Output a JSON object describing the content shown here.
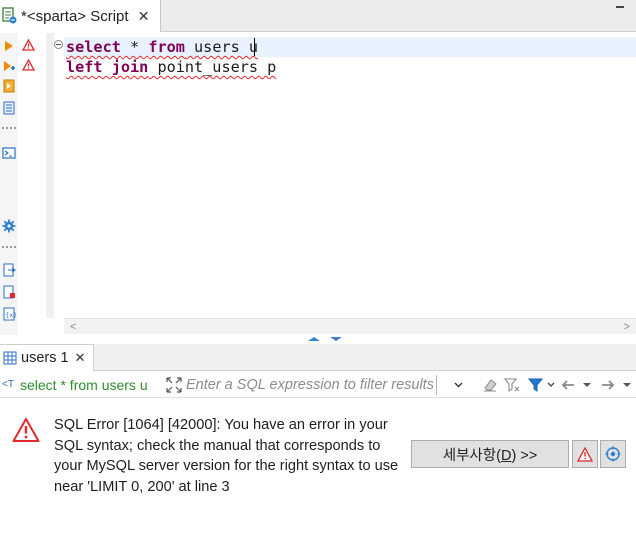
{
  "editor": {
    "tab_title": "*<sparta> Script",
    "tab_close": "✕",
    "code_lines": [
      {
        "kw1": "select",
        "mid": " * ",
        "kw2": "from",
        "rest": " users u"
      },
      {
        "kw1": "left join",
        "rest": " point_users p"
      }
    ]
  },
  "results": {
    "tab_title": "users 1",
    "tab_close": "✕",
    "query_preview": "select * from users u",
    "filter_placeholder": "Enter a SQL expression to filter results (use Ctrl+Space)"
  },
  "error": {
    "message": "SQL Error [1064] [42000]: You have an error in your SQL syntax; check the manual that corresponds to your MySQL server version for the right syntax to use near 'LIMIT 0, 200' at line 3",
    "details_label_prefix": "세부사항(",
    "details_mnemonic": "D",
    "details_label_suffix": ") >>"
  },
  "colors": {
    "keyword": "#7f0055",
    "error_red": "#e0282e",
    "current_line": "#e8f2fe",
    "query_green": "#2f8f2f"
  },
  "icons": {
    "editor_tab": "sql-script-icon",
    "results_tab": "grid-icon",
    "error": "warning-triangle-icon",
    "gutter_error": "error-marker-icon"
  }
}
